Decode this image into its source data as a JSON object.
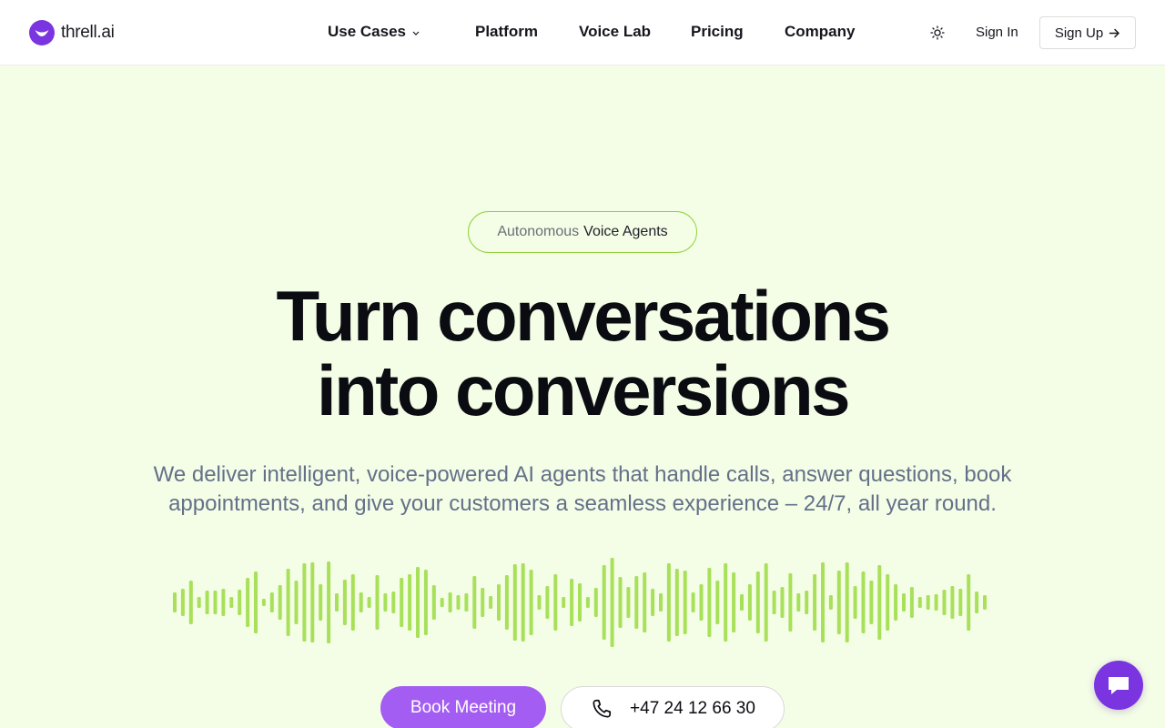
{
  "brand": {
    "name": "threll.ai",
    "logo_icon": "smile-logo-icon",
    "accent": "#7a35e0"
  },
  "nav": {
    "items": [
      {
        "label": "Use Cases",
        "has_dropdown": true
      },
      {
        "label": "Platform"
      },
      {
        "label": "Voice Lab"
      },
      {
        "label": "Pricing"
      },
      {
        "label": "Company"
      }
    ],
    "theme_icon": "sun-icon",
    "sign_in": "Sign In",
    "sign_up": "Sign Up"
  },
  "hero": {
    "badge_muted": "Autonomous",
    "badge_strong": "Voice Agents",
    "headline_line1": "Turn conversations",
    "headline_line2": "into conversions",
    "subtext": "We deliver intelligent, voice-powered AI agents that handle calls, answer questions, book appointments, and give your customers a seamless experience – 24/7, all year round.",
    "waveform_color": "#a8e05a",
    "book_meeting": "Book Meeting",
    "book_color": "#a35df2",
    "phone_number": "+47 24 12 66 30",
    "phone_icon": "phone-icon"
  },
  "chat_widget": {
    "icon": "chat-bubble-icon"
  }
}
